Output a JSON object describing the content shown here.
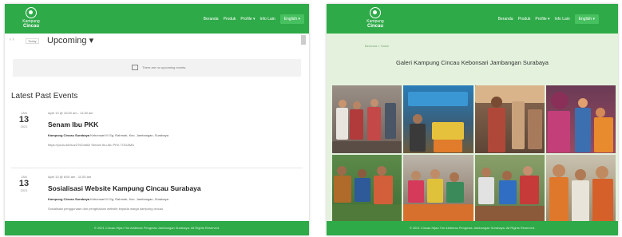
{
  "logo": {
    "line1": "Kampung",
    "line2": "Cincau"
  },
  "nav": {
    "items": [
      "Beranda",
      "Produk",
      "Profile ▾",
      "Info Lain"
    ],
    "language": "English ▾"
  },
  "left": {
    "view": {
      "today": "Today",
      "title": "Upcoming ▾"
    },
    "notice": "There are no upcoming events.",
    "section_title": "Latest Past Events",
    "events": [
      {
        "month": "JAN",
        "day": "13",
        "year": "2021",
        "time": "April 13 @ 10:00 am - 11:30 am",
        "title": "Senam Ibu PKK",
        "venue_name": "Kampung Cincau Surabaya",
        "venue_address": "Kebonsari III Gg. Rahmah, Kec. Jambangan, Surabaya",
        "description": "https://youtu.be/kuz2T6O4lAE Senam Ibu-Ibu PKK TOGAMA"
      },
      {
        "month": "JAN",
        "day": "13",
        "year": "2021",
        "time": "April 13 @ 8:00 am - 11:00 am",
        "title": "Sosialisasi Website Kampung Cincau Surabaya",
        "venue_name": "Kampung Cincau Surabaya",
        "venue_address": "Kebonsari III Gg. Rahmah, Kec. Jambangan, Surabaya",
        "description": "Sosialisasi penggunaan dan pengelolaan website kepada warga kampung cincau"
      }
    ]
  },
  "right": {
    "breadcrumb": "Beranda » Galeri",
    "title": "Galeri Kampung Cincau Kebonsari Jambangan Surabaya"
  },
  "footer": "© 2021 Cincau Hijau Tim Abdimas Pengmas Jambangan Surabaya. All Rights Reserved."
}
